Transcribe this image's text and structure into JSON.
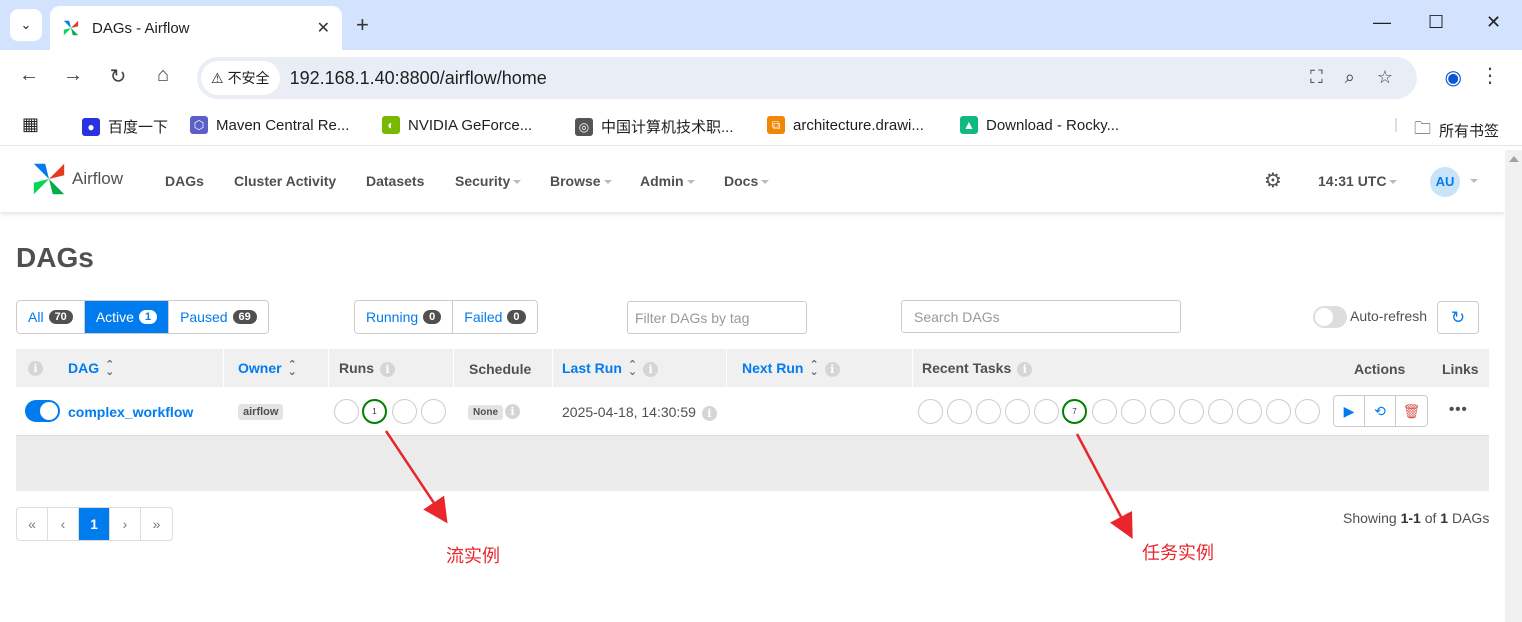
{
  "browser": {
    "tab_title": "DAGs - Airflow",
    "security_label": "不安全",
    "url": "192.168.1.40:8800/airflow/home",
    "bookmarks": [
      {
        "label": "百度一下",
        "icon": "baidu-icon",
        "color": "#2932e1"
      },
      {
        "label": "Maven Central Re...",
        "icon": "maven-icon",
        "color": "#5b5fc7"
      },
      {
        "label": "NVIDIA GeForce...",
        "icon": "nvidia-icon",
        "color": "#76b900"
      },
      {
        "label": "中国计算机技术职...",
        "icon": "org-icon",
        "color": "#555555"
      },
      {
        "label": "architecture.drawi...",
        "icon": "drawio-icon",
        "color": "#f08705"
      },
      {
        "label": "Download - Rocky...",
        "icon": "rocky-icon",
        "color": "#10b981"
      }
    ],
    "all_bookmarks_label": "所有书签"
  },
  "airflow": {
    "brand": "Airflow",
    "nav": [
      "DAGs",
      "Cluster Activity",
      "Datasets",
      "Security",
      "Browse",
      "Admin",
      "Docs"
    ],
    "time": "14:31 UTC",
    "user_initials": "AU",
    "page_title": "DAGs",
    "status_filter": [
      {
        "label": "All",
        "count": "70"
      },
      {
        "label": "Active",
        "count": "1"
      },
      {
        "label": "Paused",
        "count": "69"
      }
    ],
    "run_filter": [
      {
        "label": "Running",
        "count": "0"
      },
      {
        "label": "Failed",
        "count": "0"
      }
    ],
    "tag_filter_placeholder": "Filter DAGs by tag",
    "search_placeholder": "Search DAGs",
    "auto_refresh_label": "Auto-refresh",
    "columns": {
      "dag": "DAG",
      "owner": "Owner",
      "runs": "Runs",
      "schedule": "Schedule",
      "last_run": "Last Run",
      "next_run": "Next Run",
      "recent_tasks": "Recent Tasks",
      "actions": "Actions",
      "links": "Links"
    },
    "dag": {
      "dag_id": "complex_workflow",
      "owner": "airflow",
      "runs": [
        "",
        "1",
        "",
        ""
      ],
      "schedule": "None",
      "last_run": "2025-04-18, 14:30:59",
      "recent_tasks": [
        "",
        "",
        "",
        "",
        "",
        "7",
        "",
        "",
        "",
        "",
        "",
        "",
        "",
        ""
      ],
      "success_color": "#008000"
    },
    "pagination": [
      "«",
      "‹",
      "1",
      "›",
      "»"
    ],
    "showing": {
      "prefix": "Showing ",
      "range": "1-1",
      "mid": " of ",
      "total": "1",
      "suffix": " DAGs"
    },
    "accent_color": "#017cee"
  },
  "annotations": {
    "runs_label": "流实例",
    "tasks_label": "任务实例",
    "color": "#e8262b"
  }
}
